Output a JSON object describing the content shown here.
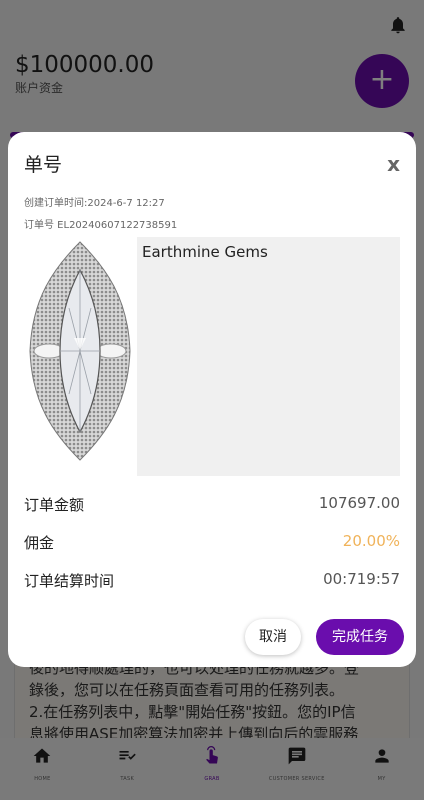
{
  "header": {
    "balance": "$100000.00",
    "balance_label": "账户资金",
    "add_symbol": "+"
  },
  "notice": {
    "lines": [
      "後的地得顺處理的，也可以处理的任務就越多。登",
      "錄後，您可以在任務頁面查看可用的任務列表。",
      "2.在任務列表中，點擊\"開始任務\"按鈕。您的IP信",
      "息將使用ASE加密算法加密并上傳到向后的雲服務"
    ]
  },
  "nav": {
    "items": [
      {
        "label": "HOME",
        "icon": "home-icon"
      },
      {
        "label": "TASK",
        "icon": "task-icon"
      },
      {
        "label": "GRAB",
        "icon": "grab-icon"
      },
      {
        "label": "CUSTOMER SERVICE",
        "icon": "chat-icon"
      },
      {
        "label": "MY",
        "icon": "person-icon"
      }
    ]
  },
  "modal": {
    "title": "单号",
    "close": "x",
    "created_time": "创建订单时间:2024-6-7 12:27",
    "order_no": "订单号 EL20240607122738591",
    "product_name": "Earthmine Gems",
    "rows": {
      "amount_label": "订单金额",
      "amount_value": "107697.00",
      "commission_label": "佣金",
      "commission_value": "20.00%",
      "settle_label": "订单结算时间",
      "settle_value": "00:719:57"
    },
    "cancel_label": "取消",
    "done_label": "完成任务"
  },
  "colors": {
    "accent": "#6a0dad",
    "commission": "#f0b35a"
  }
}
